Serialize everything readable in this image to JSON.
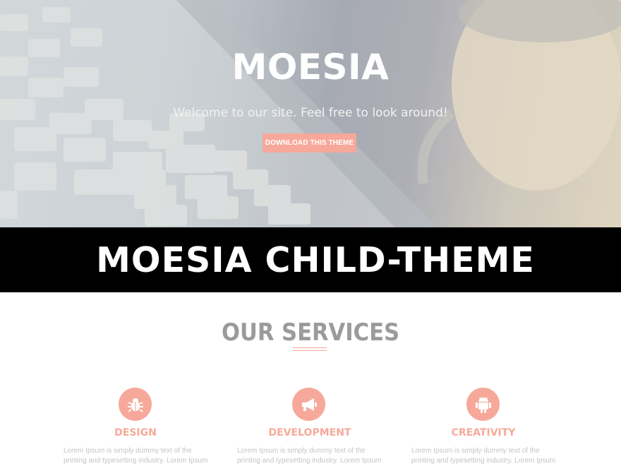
{
  "hero": {
    "title": "MOESIA",
    "subtitle": "Welcome to our site. Feel free to look around!",
    "button_label": "DOWNLOAD THIS THEME"
  },
  "banner": {
    "text": "MOESIA CHILD-THEME"
  },
  "services": {
    "title": "OUR SERVICES",
    "items": [
      {
        "icon": "bug-icon",
        "name": "DESIGN",
        "description": "Lorem Ipsum is simply dummy text of the printing and typesetting industry. Lorem Ipsum"
      },
      {
        "icon": "megaphone-icon",
        "name": "DEVELOPMENT",
        "description": "Lorem Ipsum is simply dummy text of the printing and typesetting industry. Lorem Ipsum"
      },
      {
        "icon": "android-icon",
        "name": "CREATIVITY",
        "description": "Lorem Ipsum is simply dummy text of the printing and typesetting industry. Lorem Ipsum"
      }
    ]
  },
  "colors": {
    "accent": "#f6a99a",
    "banner_bg": "#000000",
    "heading_gray": "#9b9b9b",
    "text_light": "#c4c4c4"
  }
}
